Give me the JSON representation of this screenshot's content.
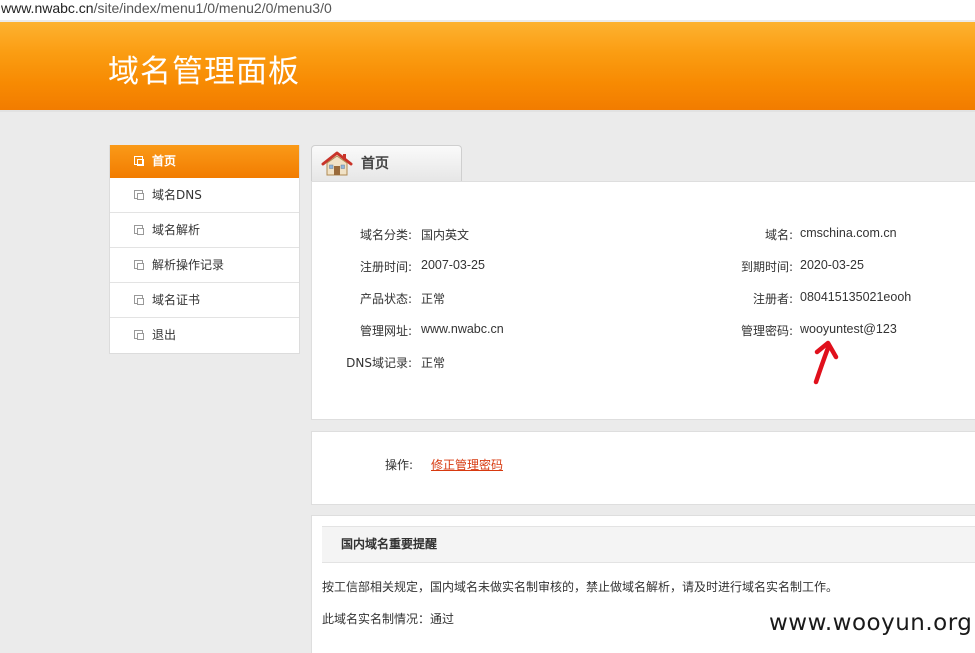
{
  "browser": {
    "url_host": "www.nwabc.cn",
    "url_path": "/site/index/menu1/0/menu2/0/menu3/0"
  },
  "header": {
    "title": "域名管理面板"
  },
  "sidebar": {
    "items": [
      {
        "label": "首页",
        "active": true
      },
      {
        "label": "域名DNS"
      },
      {
        "label": "域名解析"
      },
      {
        "label": "解析操作记录"
      },
      {
        "label": "域名证书"
      },
      {
        "label": "退出"
      }
    ]
  },
  "tab": {
    "label": "首页",
    "icon": "home-icon"
  },
  "info": {
    "left": [
      {
        "label": "域名分类:",
        "value": "国内英文"
      },
      {
        "label": "注册时间:",
        "value": "2007-03-25"
      },
      {
        "label": "产品状态:",
        "value": "正常"
      },
      {
        "label": "管理网址:",
        "value": "www.nwabc.cn"
      },
      {
        "label": "DNS域记录:",
        "value": "正常"
      }
    ],
    "right": [
      {
        "label": "域名:",
        "value": "cmschina.com.cn"
      },
      {
        "label": "到期时间:",
        "value": "2020-03-25"
      },
      {
        "label": "注册者:",
        "value": "080415135021eooh"
      },
      {
        "label": "管理密码:",
        "value": "wooyuntest@123"
      }
    ]
  },
  "operations": {
    "label": "操作:",
    "link": "修正管理密码"
  },
  "notice": {
    "title": "国内域名重要提醒",
    "line1": "按工信部相关规定，国内域名未做实名制审核的，禁止做域名解析，请及时进行域名实名制工作。",
    "line2": "此域名实名制情况：通过"
  },
  "watermark": "www.wooyun.org",
  "colors": {
    "accent_orange": "#f78a02",
    "link_red": "#d7390f",
    "arrow_red": "#e0101c"
  }
}
